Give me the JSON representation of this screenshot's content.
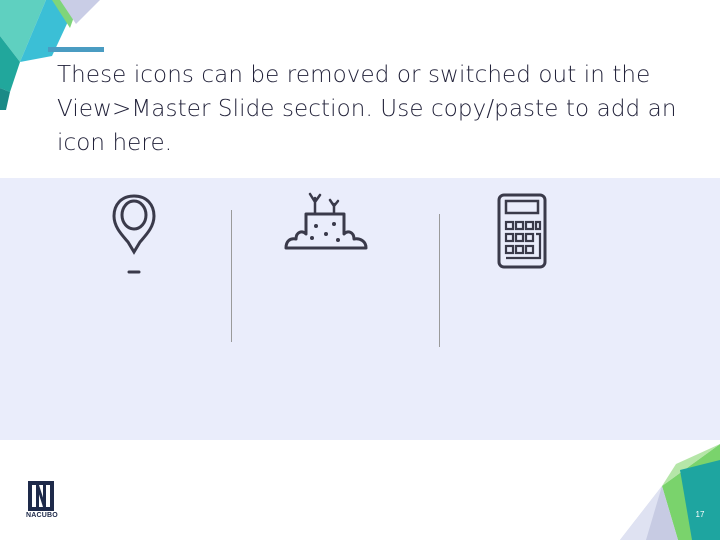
{
  "slide": {
    "body_text": "These icons can be removed or switched out in the View>Master Slide section. Use copy/paste to add an icon here.",
    "logo_text": "NACUBO",
    "page_number": "17"
  },
  "icons": [
    "map-pin-icon",
    "seedling-soil-icon",
    "calculator-icon"
  ],
  "colors": {
    "accent_blue": "#4a9cc2",
    "panel_bg": "#eaedfb",
    "teal": "#1ea5a0",
    "green": "#7ad36c",
    "light_blue": "#3cc2dc",
    "lavender": "#c7cbe3",
    "navy": "#1e2a4a"
  }
}
